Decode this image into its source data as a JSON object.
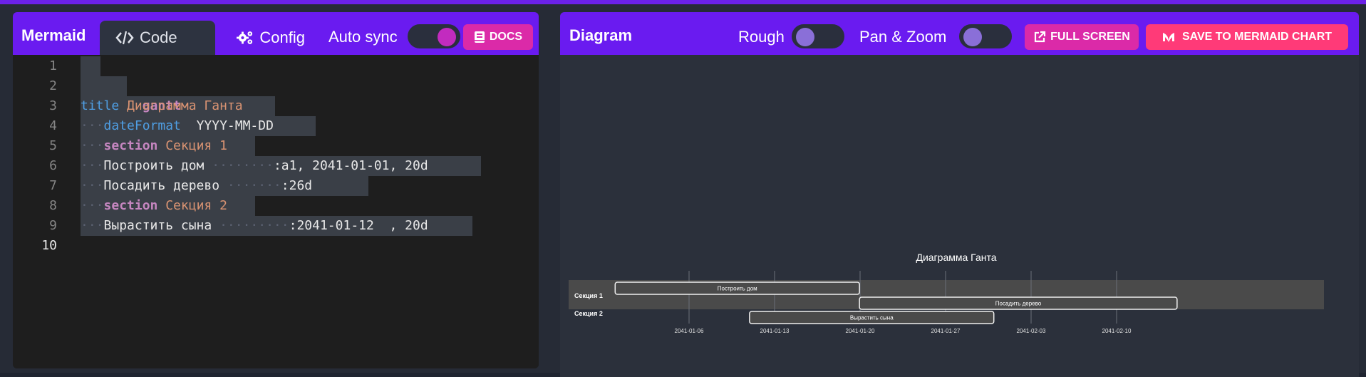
{
  "editor_panel": {
    "brand": "Mermaid",
    "tabs": [
      {
        "label": "Code",
        "active": true
      },
      {
        "label": "Config",
        "active": false
      }
    ],
    "auto_sync_label": "Auto sync",
    "auto_sync_on": true,
    "docs_label": "DOCS"
  },
  "editor": {
    "line_numbers": [
      "1",
      "2",
      "3",
      "4",
      "5",
      "6",
      "7",
      "8",
      "9",
      "10"
    ],
    "current_line": "10",
    "lines": {
      "l2": {
        "keyword": "gantt"
      },
      "l3": {
        "keyword": "title",
        "value": "Диаграмма Ганта"
      },
      "l4": {
        "indent": "···",
        "keyword": "dateFormat",
        "value": "YYYY-MM-DD"
      },
      "l5": {
        "indent": "···",
        "keyword": "section",
        "value": "Секция 1"
      },
      "l6": {
        "indent": "···",
        "text": "Построить дом ",
        "pad": "········",
        "tail": ":a1, 2041-01-01, 20d"
      },
      "l7": {
        "indent": "···",
        "text": "Посадить дерево ",
        "pad": "·······",
        "tail": ":26d"
      },
      "l8": {
        "indent": "···",
        "keyword": "section",
        "value": "Секция 2"
      },
      "l9": {
        "indent": "···",
        "text": "Вырастить сына ",
        "pad": "·········",
        "tail": ":2041-01-12  , 20d"
      }
    }
  },
  "diagram_panel": {
    "title": "Diagram",
    "rough_label": "Rough",
    "rough_on": false,
    "pan_zoom_label": "Pan & Zoom",
    "pan_zoom_on": false,
    "full_screen_label": "FULL SCREEN",
    "save_label": "SAVE TO MERMAID CHART"
  },
  "chart_data": {
    "type": "gantt",
    "title": "Диаграмма Ганта",
    "sections": [
      "Секция 1",
      "Секция 2"
    ],
    "tasks": [
      {
        "name": "Построить дом",
        "section": "Секция 1",
        "start": "2041-01-01",
        "end": "2041-01-21"
      },
      {
        "name": "Посадить дерево",
        "section": "Секция 1",
        "start": "2041-01-21",
        "end": "2041-02-16"
      },
      {
        "name": "Вырастить сына",
        "section": "Секция 2",
        "start": "2041-01-12",
        "end": "2041-02-01"
      }
    ],
    "x_ticks": [
      "2041-01-06",
      "2041-01-13",
      "2041-01-20",
      "2041-01-27",
      "2041-02-03",
      "2041-02-10"
    ],
    "x_range": [
      "2041-01-01",
      "2041-02-16"
    ]
  },
  "colors": {
    "accent": "#6a1bf0",
    "pink": "#db2aa8",
    "save": "#ff3a78"
  }
}
